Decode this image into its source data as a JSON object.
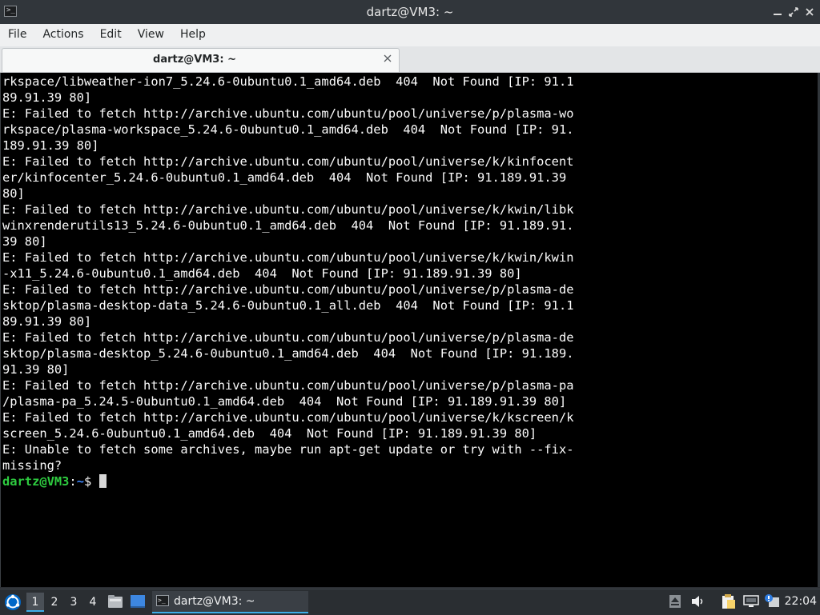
{
  "window": {
    "title": "dartz@VM3: ~",
    "icon": "terminal-icon",
    "controls": [
      "minimize-icon",
      "restore-icon",
      "close-icon"
    ]
  },
  "menubar": {
    "file": "File",
    "actions": "Actions",
    "edit": "Edit",
    "view": "View",
    "help": "Help"
  },
  "tabs": {
    "active_label": "dartz@VM3: ~",
    "close_icon": "close-icon"
  },
  "terminal": {
    "output_lines": [
      "rkspace/libweather-ion7_5.24.6-0ubuntu0.1_amd64.deb  404  Not Found [IP: 91.1",
      "89.91.39 80]",
      "E: Failed to fetch http://archive.ubuntu.com/ubuntu/pool/universe/p/plasma-wo",
      "rkspace/plasma-workspace_5.24.6-0ubuntu0.1_amd64.deb  404  Not Found [IP: 91.",
      "189.91.39 80]",
      "E: Failed to fetch http://archive.ubuntu.com/ubuntu/pool/universe/k/kinfocent",
      "er/kinfocenter_5.24.6-0ubuntu0.1_amd64.deb  404  Not Found [IP: 91.189.91.39",
      "80]",
      "E: Failed to fetch http://archive.ubuntu.com/ubuntu/pool/universe/k/kwin/libk",
      "winxrenderutils13_5.24.6-0ubuntu0.1_amd64.deb  404  Not Found [IP: 91.189.91.",
      "39 80]",
      "E: Failed to fetch http://archive.ubuntu.com/ubuntu/pool/universe/k/kwin/kwin",
      "-x11_5.24.6-0ubuntu0.1_amd64.deb  404  Not Found [IP: 91.189.91.39 80]",
      "E: Failed to fetch http://archive.ubuntu.com/ubuntu/pool/universe/p/plasma-de",
      "sktop/plasma-desktop-data_5.24.6-0ubuntu0.1_all.deb  404  Not Found [IP: 91.1",
      "89.91.39 80]",
      "E: Failed to fetch http://archive.ubuntu.com/ubuntu/pool/universe/p/plasma-de",
      "sktop/plasma-desktop_5.24.6-0ubuntu0.1_amd64.deb  404  Not Found [IP: 91.189.",
      "91.39 80]",
      "E: Failed to fetch http://archive.ubuntu.com/ubuntu/pool/universe/p/plasma-pa",
      "/plasma-pa_5.24.5-0ubuntu0.1_amd64.deb  404  Not Found [IP: 91.189.91.39 80]",
      "E: Failed to fetch http://archive.ubuntu.com/ubuntu/pool/universe/k/kscreen/k",
      "screen_5.24.6-0ubuntu0.1_amd64.deb  404  Not Found [IP: 91.189.91.39 80]",
      "E: Unable to fetch some archives, maybe run apt-get update or try with --fix-",
      "missing?"
    ],
    "prompt_user": "dartz@VM3",
    "prompt_sep": ":",
    "prompt_path": "~",
    "prompt_symbol": "$ "
  },
  "taskbar": {
    "start_icon": "lubuntu-logo-icon",
    "desktops": [
      "1",
      "2",
      "3",
      "4"
    ],
    "active_desktop": "1",
    "launchers": [
      "file-manager-icon",
      "show-desktop-icon"
    ],
    "task_label": "dartz@VM3: ~",
    "tray_icons": [
      "eject-icon",
      "volume-icon",
      "clipboard-icon",
      "network-icon",
      "update-notifier-icon"
    ],
    "clock": "22:04"
  },
  "colors": {
    "terminal_bg": "#000000",
    "terminal_fg": "#fbfbfb",
    "prompt_user": "#2ecc40",
    "prompt_path": "#3d87ff",
    "accent": "#3daee9"
  }
}
